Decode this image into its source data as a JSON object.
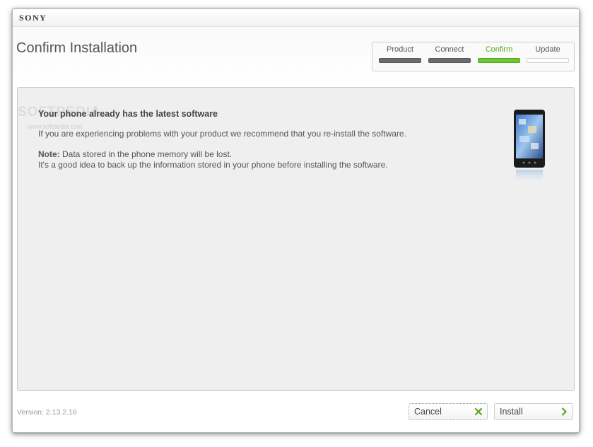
{
  "window": {
    "brand": "SONY"
  },
  "header": {
    "title": "Confirm Installation"
  },
  "steps": [
    {
      "label": "Product",
      "state": "done"
    },
    {
      "label": "Connect",
      "state": "done"
    },
    {
      "label": "Confirm",
      "state": "active"
    },
    {
      "label": "Update",
      "state": "pending"
    }
  ],
  "message": {
    "title": "Your phone already has the latest software",
    "line1": "If you are experiencing problems with your product we recommend that you re-install the software.",
    "note_label": "Note:",
    "note_text": " Data stored in the phone memory will be lost.",
    "line3": "It's a good idea to back up the information stored in your phone before installing the software."
  },
  "watermark": {
    "text": "SOFTPEDIA",
    "sub": "www.softpedia.com"
  },
  "footer": {
    "version": "Version: 2.13.2.16",
    "cancel_label": "Cancel",
    "install_label": "Install"
  },
  "colors": {
    "accent": "#6cc532",
    "done_bar": "#6b6b6b",
    "cancel_icon": "#5aa81e",
    "install_icon": "#5aa81e"
  },
  "icons": {
    "cancel": "x-icon",
    "install": "chevron-right-icon"
  }
}
